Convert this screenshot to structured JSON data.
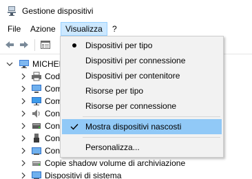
{
  "window": {
    "title": "Gestione dispositivi",
    "app_icon": "device-manager-icon"
  },
  "menubar": {
    "items": [
      {
        "label": "File"
      },
      {
        "label": "Azione"
      },
      {
        "label": "Visualizza",
        "active": true
      },
      {
        "label": "?"
      }
    ]
  },
  "toolbar": {
    "buttons": [
      {
        "icon": "back-arrow-icon"
      },
      {
        "icon": "forward-arrow-icon"
      },
      {
        "icon": "properties-icon"
      }
    ]
  },
  "tree": {
    "root_label": "MICHEL",
    "children": [
      {
        "label": "Code",
        "icon": "printer-queue-icon"
      },
      {
        "label": "Com",
        "icon": "computer-icon"
      },
      {
        "label": "Com",
        "icon": "monitor-icon"
      },
      {
        "label": "Cont",
        "icon": "audio-controller-icon"
      },
      {
        "label": "Cont",
        "icon": "storage-controller-icon"
      },
      {
        "label": "Cont",
        "icon": "usb-controller-icon"
      },
      {
        "label": "Cont",
        "icon": "network-controller-icon"
      },
      {
        "label": "Copie shadow volume di archiviazione",
        "icon": "shadow-copy-icon"
      },
      {
        "label": "Dispositivi di sistema",
        "icon": "system-devices-icon"
      }
    ]
  },
  "view_menu": {
    "items": [
      {
        "label": "Dispositivi per tipo",
        "mark": "bullet"
      },
      {
        "label": "Dispositivi per connessione",
        "mark": ""
      },
      {
        "label": "Dispositivi per contenitore",
        "mark": ""
      },
      {
        "label": "Risorse per tipo",
        "mark": ""
      },
      {
        "label": "Risorse per connessione",
        "mark": ""
      },
      {
        "label": "Mostra dispositivi nascosti",
        "mark": "check",
        "highlighted": true
      },
      {
        "label": "Personalizza...",
        "mark": ""
      }
    ]
  }
}
